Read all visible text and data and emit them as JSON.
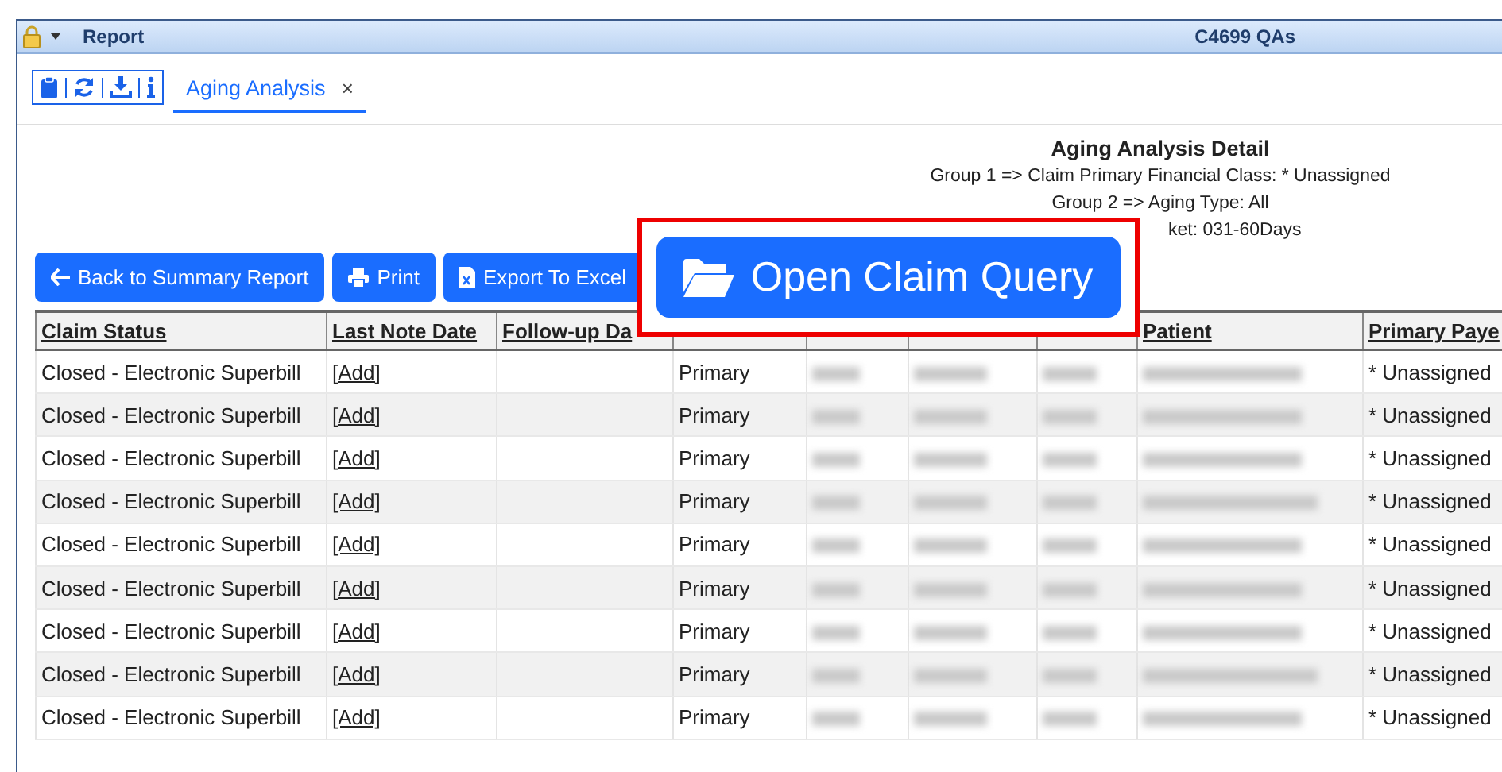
{
  "window": {
    "title": "Report",
    "subtitle": "C4699 QAs"
  },
  "tabs": [
    {
      "label": "Aging Analysis",
      "selected": true,
      "close": "×"
    }
  ],
  "report": {
    "title": "Aging Analysis Detail",
    "lines": [
      "Group 1 => Claim Primary Financial Class: * Unassigned",
      "Group 2 => Aging Type: All",
      "ket: 031-60Days"
    ]
  },
  "buttons": [
    {
      "label": "Back to Summary Report",
      "kind": "back"
    },
    {
      "label": "Print",
      "kind": "print"
    },
    {
      "label": "Export To Excel",
      "kind": "excel"
    }
  ],
  "highlight_button": {
    "label": "Open Claim Query"
  },
  "table": {
    "columns": [
      "Claim Status",
      "Last Note Date",
      "Follow-up Da",
      "",
      "",
      "",
      "",
      "Patient",
      "Primary Paye"
    ],
    "rows": [
      {
        "status": "Closed - Electronic Superbill",
        "note": "[Add]",
        "type": "Primary",
        "payer": "* Unassigned"
      },
      {
        "status": "Closed - Electronic Superbill",
        "note": "[Add]",
        "type": "Primary",
        "payer": "* Unassigned"
      },
      {
        "status": "Closed - Electronic Superbill",
        "note": "[Add]",
        "type": "Primary",
        "payer": "* Unassigned"
      },
      {
        "status": "Closed - Electronic Superbill",
        "note": "[Add]",
        "type": "Primary",
        "payer": "* Unassigned"
      },
      {
        "status": "Closed - Electronic Superbill",
        "note": "[Add]",
        "type": "Primary",
        "payer": "* Unassigned"
      },
      {
        "status": "Closed - Electronic Superbill",
        "note": "[Add]",
        "type": "Primary",
        "payer": "* Unassigned"
      },
      {
        "status": "Closed - Electronic Superbill",
        "note": "[Add]",
        "type": "Primary",
        "payer": "* Unassigned"
      },
      {
        "status": "Closed - Electronic Superbill",
        "note": "[Add]",
        "type": "Primary",
        "payer": "* Unassigned"
      },
      {
        "status": "Closed - Electronic Superbill",
        "note": "[Add]",
        "type": "Primary",
        "payer": "* Unassigned"
      }
    ]
  }
}
